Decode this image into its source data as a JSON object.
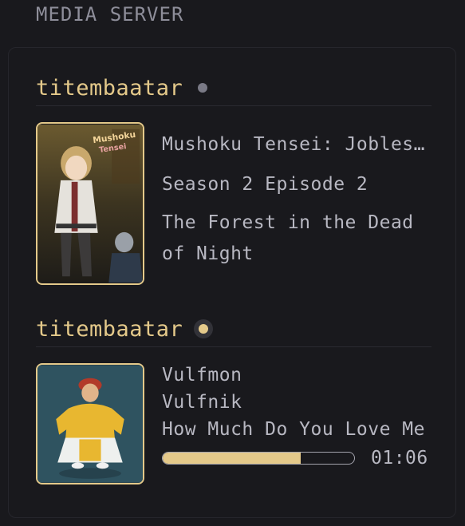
{
  "section": {
    "title": "MEDIA SERVER"
  },
  "sessions": [
    {
      "user": "titembaatar",
      "status": "paused",
      "media": {
        "title": "Mushoku Tensei: Jobless Reincarnation",
        "subtitle": "Season 2 Episode 2",
        "episode_title": "The Forest in the Dead of Night",
        "poster_text": "Mushoku Tensei",
        "poster_icon": "anime-poster"
      }
    },
    {
      "user": "titembaatar",
      "status": "playing",
      "media": {
        "artist": "Vulfmon",
        "album": "Vulfnik",
        "track": "How Much Do You Love Me",
        "cover_icon": "album-cover",
        "progress": 0.72,
        "time": "01:06"
      }
    }
  ],
  "colors": {
    "accent": "#e4c98a",
    "text": "#b8b8c2",
    "muted": "#8e8e9a",
    "background": "#19191d"
  }
}
